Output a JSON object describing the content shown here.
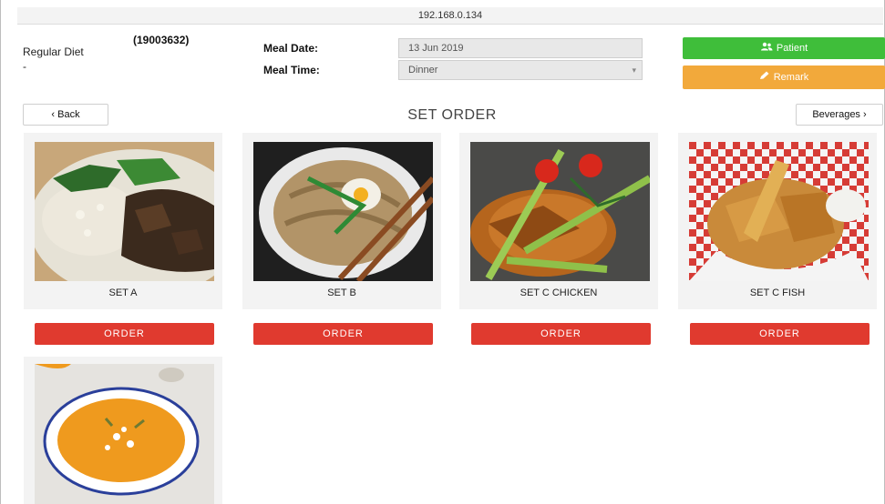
{
  "address_bar": {
    "url": "192.168.0.134"
  },
  "patient": {
    "diet": "Regular Diet",
    "dash": "-",
    "id": "(19003632)"
  },
  "meal": {
    "date_label": "Meal Date:",
    "time_label": "Meal Time:",
    "date_value": "13 Jun 2019",
    "time_value": "Dinner"
  },
  "buttons": {
    "patient_label": "Patient",
    "remark_label": "Remark",
    "back_label": "‹ Back",
    "beverages_label": "Beverages ›",
    "patient_color": "#3fbe3a",
    "remark_color": "#f2a93b",
    "order_color": "#e03a2f"
  },
  "page_title": "SET ORDER",
  "sets": [
    {
      "name": "SET A",
      "order_label": "ORDER"
    },
    {
      "name": "SET B",
      "order_label": "ORDER"
    },
    {
      "name": "SET C CHICKEN",
      "order_label": "ORDER"
    },
    {
      "name": "SET C FISH",
      "order_label": "ORDER"
    }
  ],
  "icons": {
    "patient": "users-icon",
    "remark": "pencil-icon",
    "select": "chevron-down-icon"
  }
}
